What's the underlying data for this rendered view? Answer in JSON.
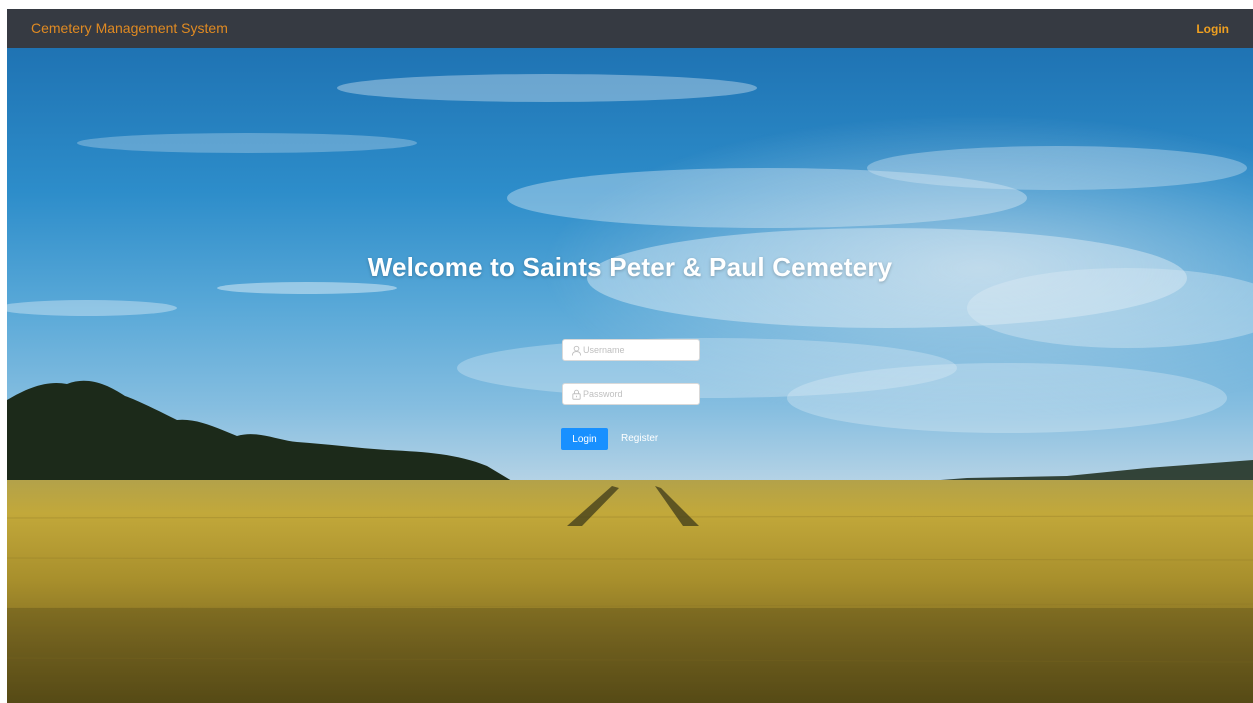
{
  "navbar": {
    "brand": "Cemetery Management System",
    "login_link": "Login"
  },
  "hero": {
    "welcome": "Welcome to Saints Peter & Paul Cemetery"
  },
  "login_form": {
    "username": {
      "placeholder": "Username",
      "value": "",
      "icon": "user-icon"
    },
    "password": {
      "placeholder": "Password",
      "value": "",
      "icon": "lock-icon"
    },
    "login_button": "Login",
    "register_link": "Register"
  },
  "colors": {
    "navbar_bg": "#363a42",
    "brand": "#e08a22",
    "nav_login": "#f0a020",
    "primary_button": "#1890ff"
  }
}
